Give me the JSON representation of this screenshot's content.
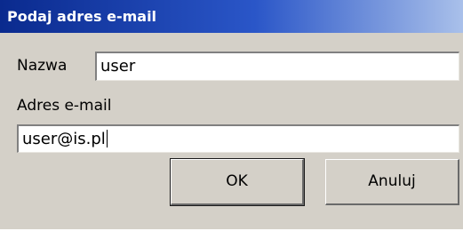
{
  "dialog": {
    "title": "Podaj adres e-mail",
    "name_label": "Nazwa",
    "name_value": "user",
    "email_label": "Adres e-mail",
    "email_value": "user@is.pl",
    "ok_label": "OK",
    "cancel_label": "Anuluj"
  },
  "colors": {
    "titlebar_start": "#0a2a8e",
    "titlebar_end": "#a9c0ea",
    "dialog_background": "#d4d0c8",
    "input_background": "#ffffff"
  }
}
